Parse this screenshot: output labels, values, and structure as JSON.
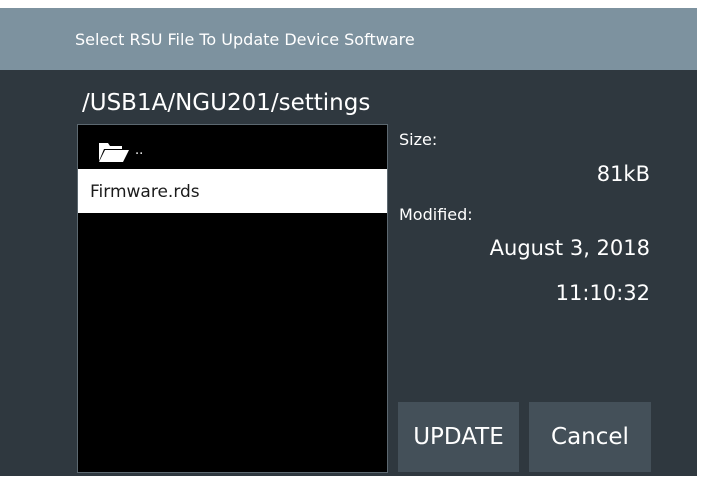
{
  "dialog": {
    "title": "Select RSU File To Update Device Software",
    "path": "/USB1A/NGU201/settings"
  },
  "file_list": {
    "parent_label": "..",
    "files": [
      "Firmware.rds"
    ],
    "selected_index": 0
  },
  "details": {
    "size_label": "Size:",
    "size_value": "81kB",
    "modified_label": "Modified:",
    "modified_date": "August 3, 2018",
    "modified_time": "11:10:32"
  },
  "buttons": {
    "update_label": "UPDATE",
    "cancel_label": "Cancel"
  },
  "colors": {
    "title_bar": "#7d929f",
    "dialog_bg": "#2f383f",
    "button_bg": "#445059",
    "list_bg": "#000000",
    "selected_row": "#ffffff"
  }
}
